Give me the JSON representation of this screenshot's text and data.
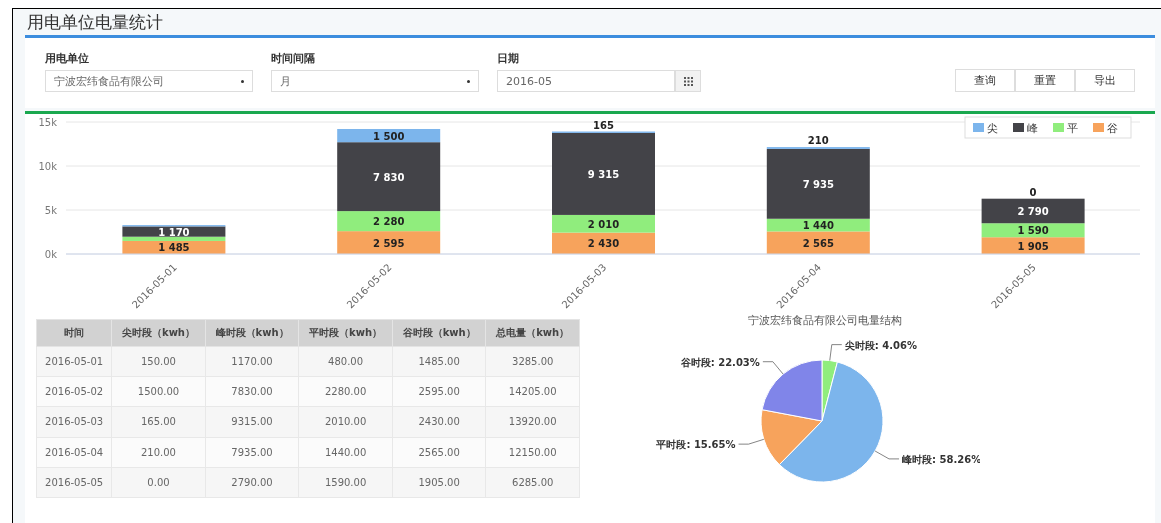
{
  "page_title": "用电单位电量统计",
  "filters": [
    {
      "kind": "select",
      "label": "用电单位",
      "value": "宁波宏纬食品有限公司"
    },
    {
      "kind": "select",
      "label": "时间间隔",
      "value": "月"
    },
    {
      "kind": "date",
      "label": "日期",
      "value": "2016-05"
    }
  ],
  "buttons": [
    "查询",
    "重置",
    "导出"
  ],
  "bar_chart": {
    "chart_data": {
      "type": "bar",
      "stacked": true,
      "categories": [
        "2016-05-01",
        "2016-05-02",
        "2016-05-03",
        "2016-05-04",
        "2016-05-05"
      ],
      "ylim": [
        0,
        15000
      ],
      "yticks": [
        {
          "value": 0,
          "label": "0k"
        },
        {
          "value": 5000,
          "label": "5k"
        },
        {
          "value": 10000,
          "label": "10k"
        },
        {
          "value": 15000,
          "label": "15k"
        }
      ],
      "legend": true,
      "series": [
        {
          "name": "尖",
          "color": "#7cb5ec",
          "values": [
            150,
            1500,
            165,
            210,
            0
          ],
          "value_labels": [
            null,
            "1 500",
            "165",
            "210",
            "0"
          ]
        },
        {
          "name": "峰",
          "color": "#434348",
          "values": [
            1170,
            7830,
            9315,
            7935,
            2790
          ],
          "value_labels": [
            "1 170",
            "7 830",
            "9 315",
            "7 935",
            "2 790"
          ]
        },
        {
          "name": "平",
          "color": "#90ed7d",
          "values": [
            480,
            2280,
            2010,
            1440,
            1590
          ],
          "value_labels": [
            null,
            "2 280",
            "2 010",
            "1 440",
            "1 590"
          ]
        },
        {
          "name": "谷",
          "color": "#f7a35c",
          "values": [
            1485,
            2595,
            2430,
            2565,
            1905
          ],
          "value_labels": [
            "1 485",
            "2 595",
            "2 430",
            "2 565",
            "1 905"
          ]
        }
      ]
    }
  },
  "table": {
    "columns": [
      "时间",
      "尖时段（kwh）",
      "峰时段（kwh）",
      "平时段（kwh）",
      "谷时段（kwh）",
      "总电量（kwh）"
    ],
    "rows": [
      [
        "2016-05-01",
        "150.00",
        "1170.00",
        "480.00",
        "1485.00",
        "3285.00"
      ],
      [
        "2016-05-02",
        "1500.00",
        "7830.00",
        "2280.00",
        "2595.00",
        "14205.00"
      ],
      [
        "2016-05-03",
        "165.00",
        "9315.00",
        "2010.00",
        "2430.00",
        "13920.00"
      ],
      [
        "2016-05-04",
        "210.00",
        "7935.00",
        "1440.00",
        "2565.00",
        "12150.00"
      ],
      [
        "2016-05-05",
        "0.00",
        "2790.00",
        "1590.00",
        "1905.00",
        "6285.00"
      ]
    ]
  },
  "pie_chart": {
    "chart_data": {
      "type": "pie",
      "title": "宁波宏纬食品有限公司电量结构",
      "values": [
        4.06,
        58.26,
        15.65,
        22.03
      ],
      "colors": [
        "#90ed7d",
        "#7cb5ec",
        "#f7a35c",
        "#8085e9"
      ],
      "value_labels": [
        "尖时段: 4.06%",
        "峰时段: 58.26%",
        "平时段: 15.65%",
        "谷时段: 22.03%"
      ]
    }
  }
}
